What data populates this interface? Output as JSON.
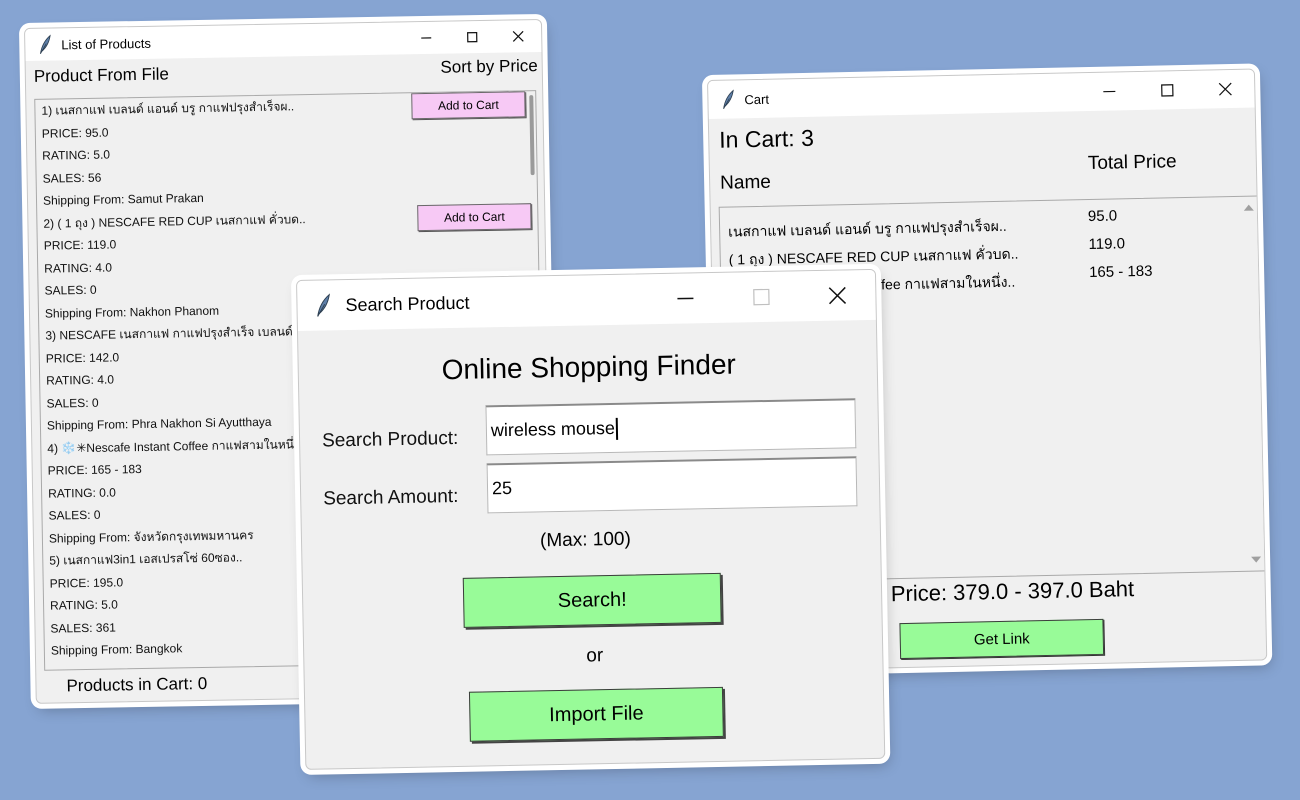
{
  "colors": {
    "background": "#86a4d2",
    "window_bg": "#f0f0f0",
    "add_to_cart_button": "#f7c9f5",
    "green_button": "#98fb98"
  },
  "list_window": {
    "title": "List of Products",
    "header_left": "Product From File",
    "header_right": "Sort by Price",
    "add_to_cart_label": "Add to Cart",
    "lines": [
      "1) เนสกาแฟ เบลนด์ แอนด์ บรู กาแฟปรุงสำเร็จผ..",
      "PRICE: 95.0",
      "RATING: 5.0",
      "SALES: 56",
      "Shipping From: Samut Prakan",
      "2) ( 1 ถุง ) NESCAFE RED CUP เนสกาแฟ คั่วบด..",
      "PRICE: 119.0",
      "RATING: 4.0",
      "SALES: 0",
      "Shipping From: Nakhon Phanom",
      "3) NESCAFE เนสกาแฟ กาแฟปรุงสำเร็จ เบลนด์แอน..",
      "PRICE: 142.0",
      "RATING: 4.0",
      "SALES: 0",
      "Shipping From: Phra Nakhon Si Ayutthaya",
      "4) ❄️✳Nescafe Instant Coffee กาแฟสามในหนึ่ง..",
      "PRICE: 165 - 183",
      "RATING: 0.0",
      "SALES: 0",
      "Shipping From: จังหวัดกรุงเทพมหานคร",
      "5) เนสกาแฟ3in1 เอสเปรสโซ่ 60ซอง..",
      "PRICE: 195.0",
      "RATING: 5.0",
      "SALES: 361",
      "Shipping From: Bangkok"
    ],
    "footer": "Products in Cart: 0"
  },
  "cart_window": {
    "title": "Cart",
    "in_cart": "In Cart: 3",
    "col_name": "Name",
    "col_price": "Total Price",
    "rows": [
      {
        "name": "เนสกาแฟ เบลนด์ แอนด์ บรู กาแฟปรุงสำเร็จผ..",
        "price": "95.0"
      },
      {
        "name": "( 1 ถุง ) NESCAFE RED CUP เนสกาแฟ คั่วบด..",
        "price": "119.0"
      },
      {
        "name": "❄️✳Nescafe Instant Coffee กาแฟสามในหนึ่ง..",
        "price": "165 - 183"
      }
    ],
    "total": "Price: 379.0 - 397.0 Baht",
    "get_link_label": "Get Link"
  },
  "search_window": {
    "title": "Search Product",
    "heading": "Online Shopping Finder",
    "product_label": "Search Product:",
    "product_value": "wireless mouse",
    "amount_label": "Search Amount:",
    "amount_value": "25",
    "max_note": "(Max: 100)",
    "search_button": "Search!",
    "or_text": "or",
    "import_button": "Import File"
  }
}
